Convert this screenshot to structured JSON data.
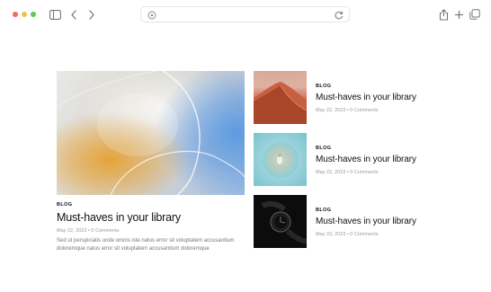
{
  "browser": {
    "url": "",
    "traffic_lights": {
      "close": "#ee6a5f",
      "minimize": "#f5bd4f",
      "zoom": "#61c454"
    }
  },
  "featured": {
    "category": "BLOG",
    "title": "Must-haves in your library",
    "meta": "May 22, 2023 • 0 Comments",
    "excerpt": "Sed ut perspiciatis unde omnis iste natus error sit voluptatem accusantium doloremque natus error sit voluptatem accusantium doloremque",
    "image": "abstract-gradient-image"
  },
  "posts": [
    {
      "category": "BLOG",
      "title": "Must-haves in your library",
      "meta": "May 22, 2023 • 0 Comments",
      "image": "desert-dune-image"
    },
    {
      "category": "BLOG",
      "title": "Must-haves in your library",
      "meta": "May 22, 2023 • 0 Comments",
      "image": "beach-aerial-image"
    },
    {
      "category": "BLOG",
      "title": "Must-haves in your library",
      "meta": "May 22, 2023 • 0 Comments",
      "image": "watch-image"
    }
  ]
}
